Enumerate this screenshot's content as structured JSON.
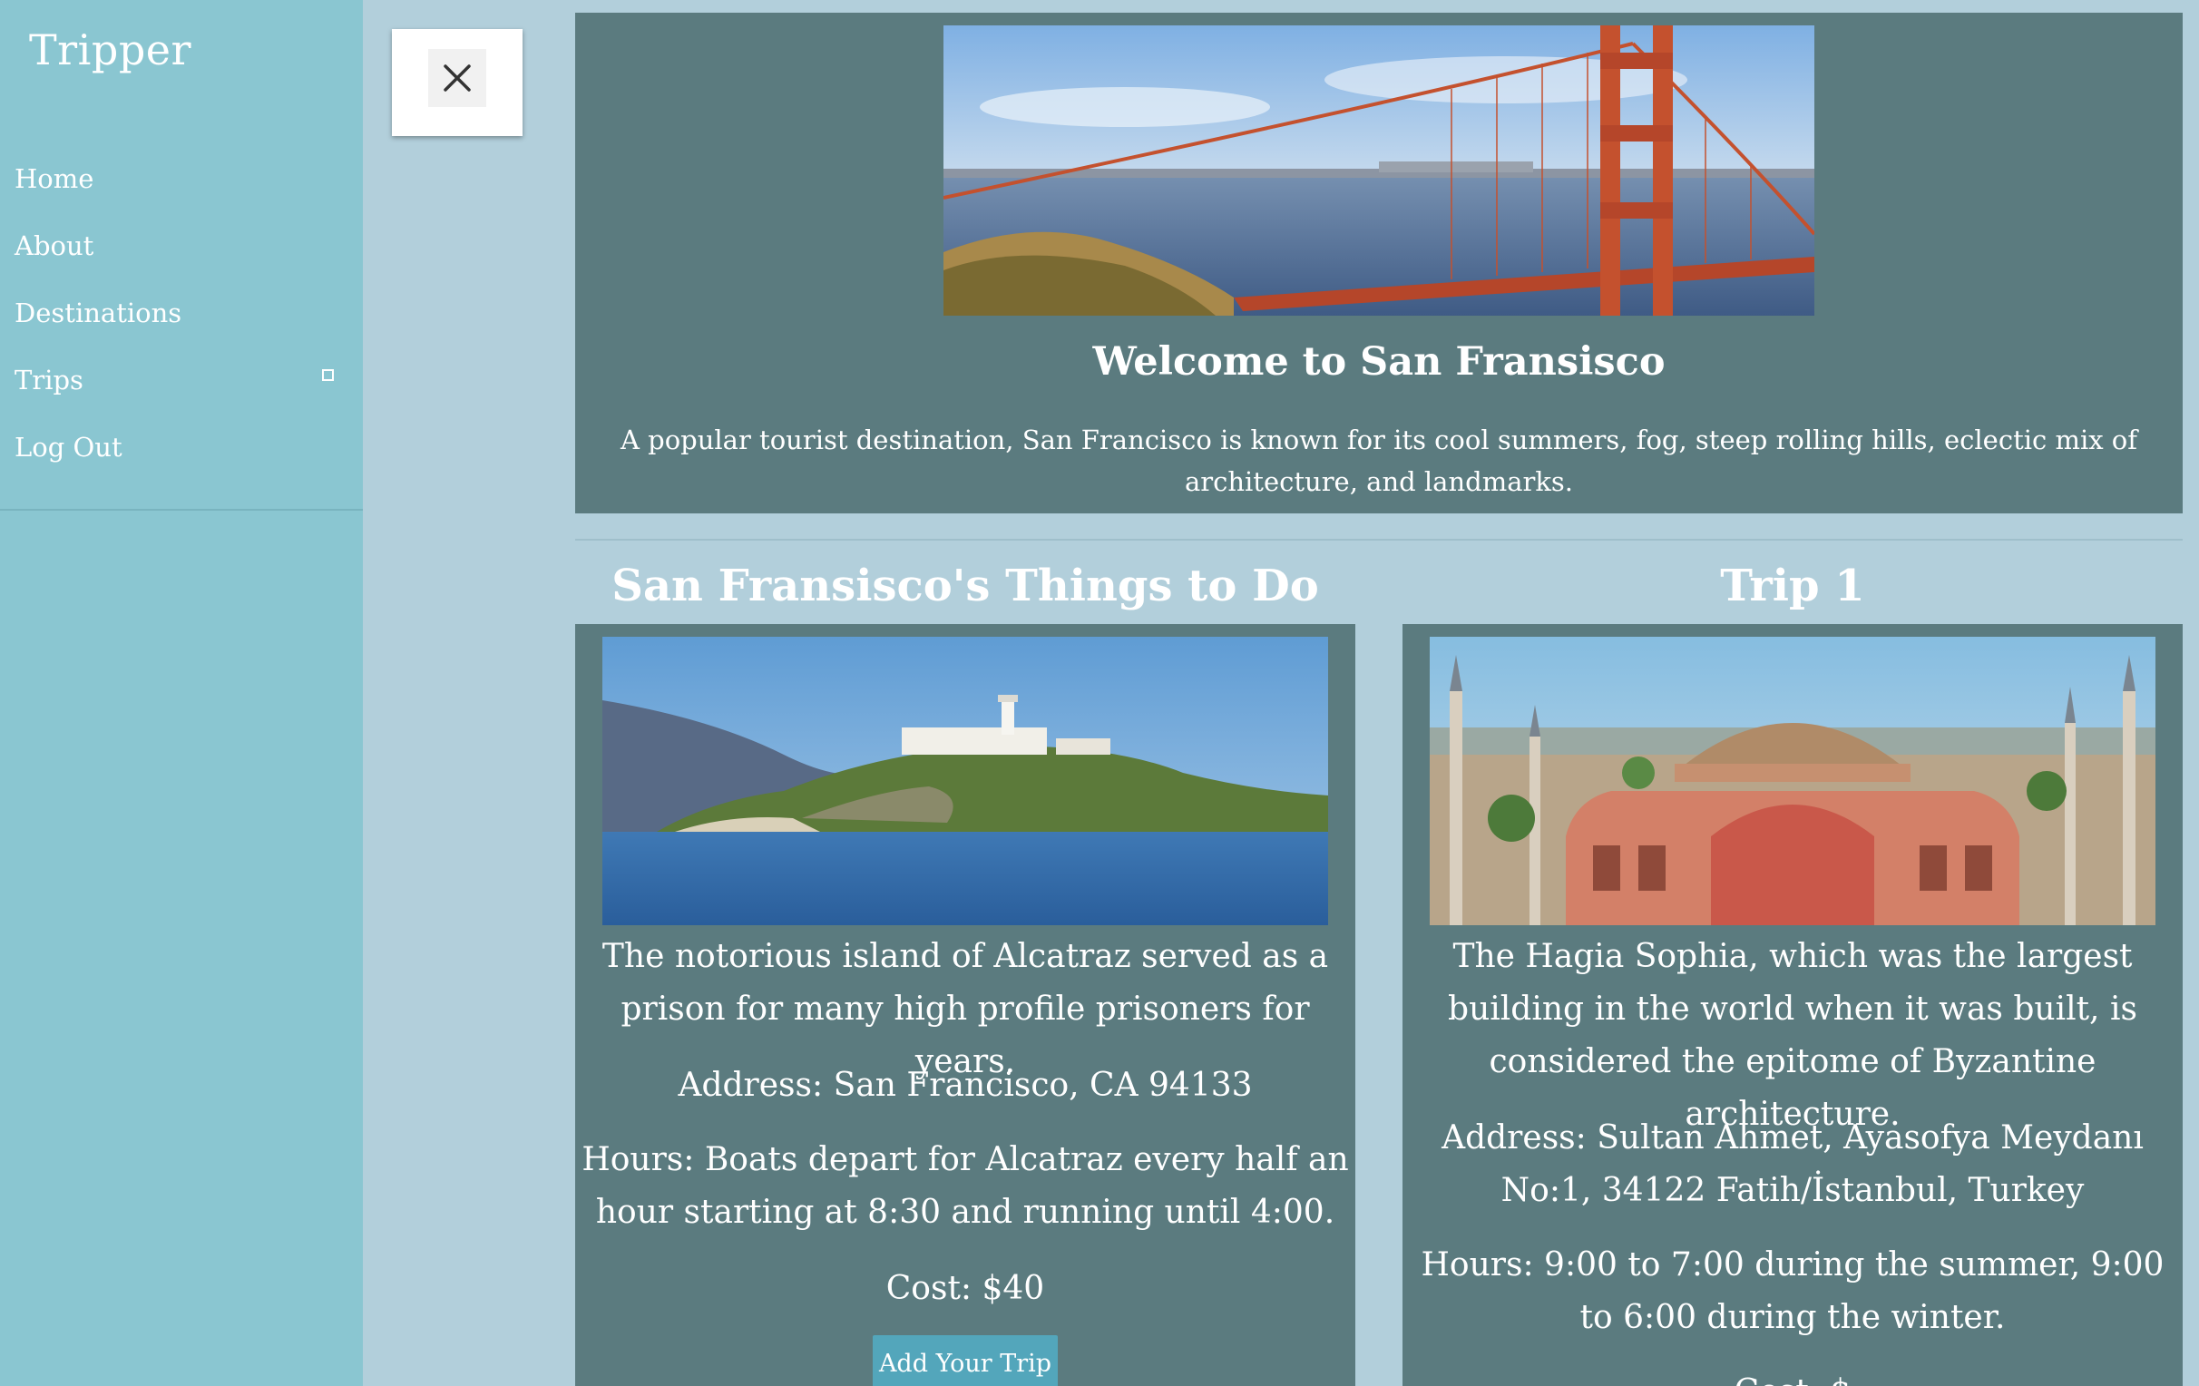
{
  "sidebar": {
    "brand": "Tripper",
    "items": [
      {
        "label": "Home"
      },
      {
        "label": "About"
      },
      {
        "label": "Destinations"
      },
      {
        "label": "Trips"
      },
      {
        "label": "Log Out"
      }
    ]
  },
  "close_button": {
    "icon": "close-icon"
  },
  "hero": {
    "image": "golden-gate-bridge",
    "title": "Welcome to San Fransisco",
    "description": "A popular tourist destination, San Francisco is known for its cool summers, fog, steep rolling hills, eclectic mix of architecture, and landmarks."
  },
  "things_to_do": {
    "title": "San Fransisco's Things to Do",
    "image": "alcatraz-island",
    "description": "The notorious island of Alcatraz served as a prison for many high profile prisoners for years.",
    "address": "Address: San Francisco, CA 94133",
    "hours": "Hours: Boats depart for Alcatraz every half an hour starting at 8:30 and running until 4:00.",
    "cost": "Cost: $40",
    "add_button": "Add Your Trip"
  },
  "trip": {
    "title": "Trip 1",
    "image": "hagia-sophia",
    "description": "The Hagia Sophia, which was the largest building in the world when it was built, is considered the epitome of Byzantine architecture.",
    "address": "Address: Sultan Ahmet, Ayasofya Meydanı No:1, 34122 Fatih/İstanbul, Turkey",
    "hours": "Hours: 9:00 to 7:00 during the summer, 9:00 to 6:00 during the winter.",
    "cost": "Cost: $"
  },
  "colors": {
    "sidebar": "#8ac6d1",
    "background": "#b2cfdb",
    "card": "#5b7b7f",
    "button": "#53a6bb"
  }
}
